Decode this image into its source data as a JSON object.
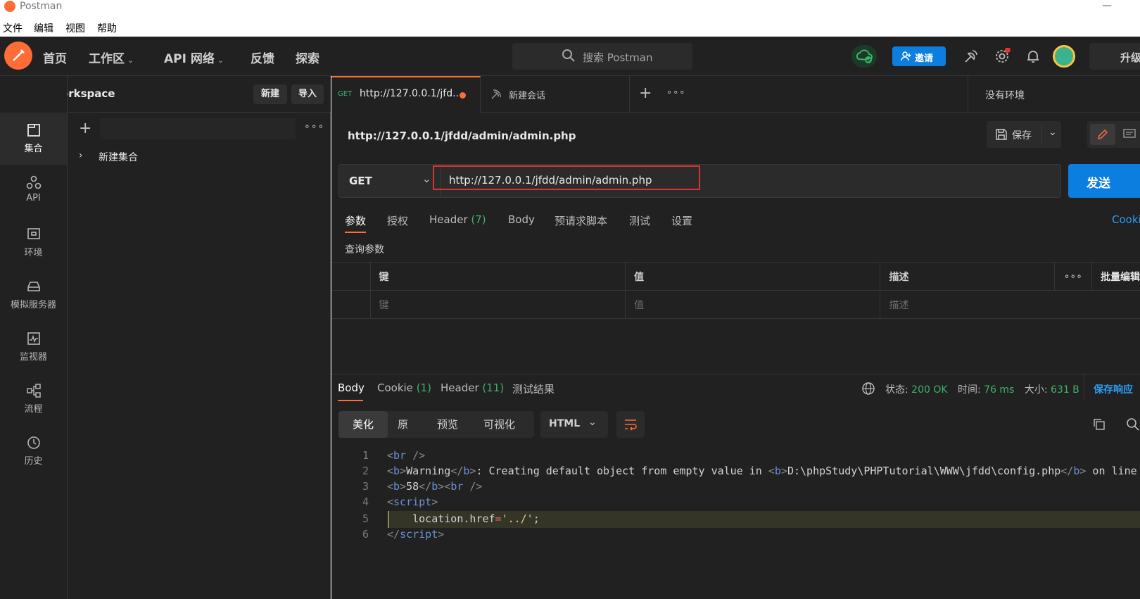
{
  "titlebar": {
    "app_title": "Postman",
    "minimize": "—"
  },
  "menubar": {
    "items": [
      "文件",
      "编辑",
      "视图",
      "帮助"
    ]
  },
  "header": {
    "nav": [
      "首页",
      "工作区",
      "API 网络",
      "反馈",
      "探索"
    ],
    "search_placeholder": "搜索 Postman",
    "invite_label": "邀请",
    "upgrade_label": "升级"
  },
  "workspace": {
    "name": "My Workspace",
    "new_label": "新建",
    "import_label": "导入"
  },
  "rail": {
    "items": [
      {
        "label": "集合",
        "icon": "collection-icon"
      },
      {
        "label": "API",
        "icon": "api-icon"
      },
      {
        "label": "环境",
        "icon": "environment-icon"
      },
      {
        "label": "模拟服务器",
        "icon": "mock-server-icon"
      },
      {
        "label": "监视器",
        "icon": "monitor-icon"
      },
      {
        "label": "流程",
        "icon": "flow-icon"
      },
      {
        "label": "历史",
        "icon": "history-icon"
      }
    ]
  },
  "panel": {
    "collection_name": "新建集合"
  },
  "tabs": {
    "tab1_method": "GET",
    "tab1_title": "http://127.0.0.1/jfd...",
    "tab2_title": "新建会话",
    "env_label": "没有环境"
  },
  "request": {
    "name": "http://127.0.0.1/jfdd/admin/admin.php",
    "save_label": "保存",
    "method": "GET",
    "url": "http://127.0.0.1/jfdd/admin/admin.php",
    "send_label": "发送",
    "subtabs": [
      "参数",
      "授权",
      "Header",
      "Body",
      "预请求脚本",
      "测试",
      "设置"
    ],
    "header_count": "(7)",
    "cookies_label": "Cookie",
    "query_params_title": "查询参数",
    "table_headers": [
      "键",
      "值",
      "描述",
      "批量编辑"
    ],
    "table_placeholders": [
      "键",
      "值",
      "描述"
    ]
  },
  "response": {
    "tabs": [
      "Body",
      "Cookie",
      "Header",
      "测试结果"
    ],
    "cookie_count": "(1)",
    "header_count": "(11)",
    "status_label": "状态:",
    "status_value": "200 OK",
    "time_label": "时间:",
    "time_value": "76 ms",
    "size_label": "大小:",
    "size_value": "631 B",
    "save_response_label": "保存响应",
    "view_modes": [
      "美化",
      "原",
      "预览",
      "可视化"
    ],
    "format": "HTML",
    "code_lines": [
      "1",
      "2",
      "3",
      "4",
      "5",
      "6"
    ],
    "code_text": {
      "l1": "br",
      "l2_a": "Warning",
      "l2_b": ": Creating default object from empty value in ",
      "l2_path": "D:\\phpStudy\\PHPTutorial\\WWW\\jfdd\\config.php",
      "l2_c": " on line",
      "l3_num": "58",
      "l4": "script",
      "l5_a": "location.href",
      "l5_b": "'../'",
      "l6": "script"
    }
  },
  "colors": {
    "accent": "#ff6c37",
    "primary_blue": "#0c7ee0",
    "status_green": "#3bb36a",
    "bg": "#212121"
  }
}
